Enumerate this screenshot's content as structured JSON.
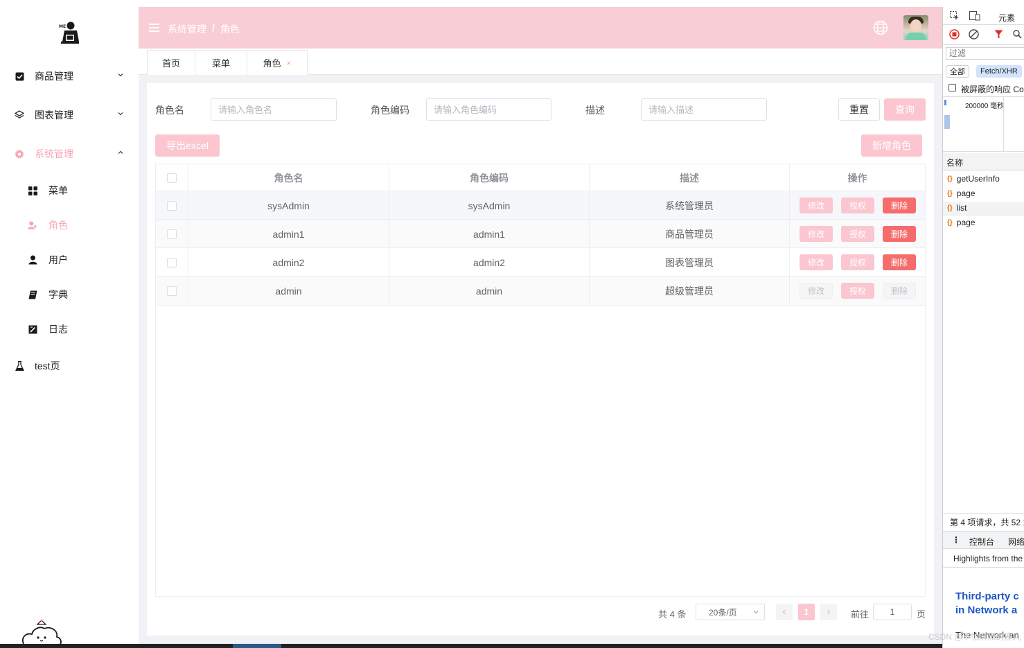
{
  "sidebar": {
    "menu": [
      {
        "label": "商品管理",
        "icon": "checkbox-icon"
      },
      {
        "label": "图表管理",
        "icon": "layers-icon"
      },
      {
        "label": "系统管理",
        "icon": "gear-icon"
      }
    ],
    "submenu": [
      {
        "label": "菜单",
        "icon": "grid-icon"
      },
      {
        "label": "角色",
        "icon": "user-role-icon"
      },
      {
        "label": "用户",
        "icon": "user-icon"
      },
      {
        "label": "字典",
        "icon": "book-icon"
      },
      {
        "label": "日志",
        "icon": "log-icon"
      }
    ],
    "test_label": "test页"
  },
  "header": {
    "breadcrumb": [
      "系统管理",
      "角色"
    ],
    "breadcrumb_sep": "/"
  },
  "tabs": [
    {
      "label": "首页"
    },
    {
      "label": "菜单"
    },
    {
      "label": "角色",
      "close": "×"
    }
  ],
  "filters": {
    "role_name": {
      "label": "角色名",
      "placeholder": "请输入角色名"
    },
    "role_code": {
      "label": "角色编码",
      "placeholder": "请输入角色编码"
    },
    "description": {
      "label": "描述",
      "placeholder": "请输入描述"
    },
    "reset_label": "重置",
    "search_label": "查询"
  },
  "toolbar": {
    "export_label": "导出excel",
    "add_label": "新增角色"
  },
  "table": {
    "columns": [
      "角色名",
      "角色编码",
      "描述",
      "操作"
    ],
    "rows": [
      {
        "name": "sysAdmin",
        "code": "sysAdmin",
        "desc": "系统管理员"
      },
      {
        "name": "admin1",
        "code": "admin1",
        "desc": "商品管理员"
      },
      {
        "name": "admin2",
        "code": "admin2",
        "desc": "图表管理员"
      },
      {
        "name": "admin",
        "code": "admin",
        "desc": "超级管理员"
      }
    ],
    "actions": {
      "edit": "修改",
      "auth": "授权",
      "delete": "删除"
    }
  },
  "pagination": {
    "total": "共 4 条",
    "page_size": "20条/页",
    "current_page": "1",
    "goto_label": "前往",
    "goto_value": "1",
    "page_suffix": "页"
  },
  "devtools": {
    "tab_elements": "元素",
    "filter_placeholder": "过滤",
    "pill_all": "全部",
    "pill_fetch": "Fetch/XHR",
    "blocked_label": "被屏蔽的响应 Co",
    "timeline_label": "200000 毫秒",
    "name_header": "名称",
    "requests": [
      "getUserInfo",
      "page",
      "list",
      "page"
    ],
    "summary": "第 4 项请求，共 52 1",
    "drawer_console": "控制台",
    "drawer_network": "网络",
    "highlights": "Highlights from the",
    "promo_line1": "Third-party c",
    "promo_line2": "in Network a",
    "promo_line3": "The Network an"
  },
  "watermark": "CSDN @不怕麻烦的鹿丸",
  "colors": {
    "accent": "#f9cdd5",
    "accent_button": "#fbc6d0",
    "danger": "#f56c6c",
    "active_text": "#f8a6b5"
  }
}
